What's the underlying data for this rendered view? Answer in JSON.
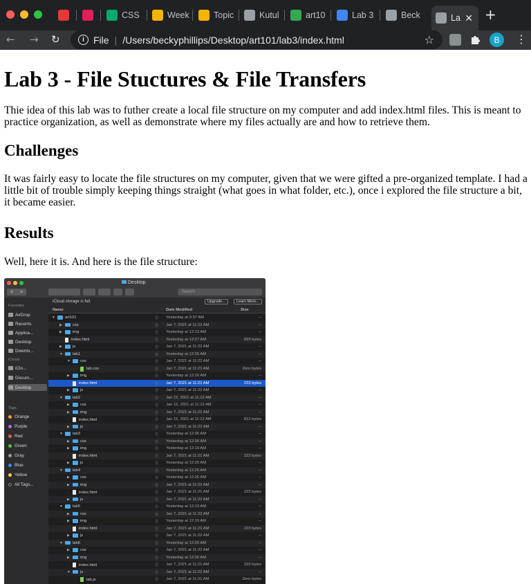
{
  "browser": {
    "tabs": [
      {
        "label": "",
        "icon": "recorder-icon",
        "color": "#e53935"
      },
      {
        "label": "",
        "icon": "slack-icon",
        "color": "#e01e5a"
      },
      {
        "label": "CSS",
        "icon": "w3schools-icon",
        "color": "#04aa6d"
      },
      {
        "label": "Week",
        "icon": "slides-icon",
        "color": "#f4b400"
      },
      {
        "label": "Topic",
        "icon": "slides-icon",
        "color": "#f4b400"
      },
      {
        "label": "Kutul",
        "icon": "globe-icon",
        "color": "#9aa0a6"
      },
      {
        "label": "art10",
        "icon": "drive-icon",
        "color": "#34a853"
      },
      {
        "label": "Lab 3",
        "icon": "docs-icon",
        "color": "#4285f4"
      },
      {
        "label": "Beck",
        "icon": "globe-icon",
        "color": "#9aa0a6"
      },
      {
        "label": "La",
        "icon": "globe-icon",
        "color": "#9aa0a6",
        "active": true
      }
    ],
    "address": {
      "scheme": "File",
      "path": "/Users/beckyphillips/Desktop/art101/lab3/index.html"
    },
    "profile_initial": "B"
  },
  "page": {
    "title": "Lab 3 - File Stuctures & File Transfers",
    "intro": "Thie idea of this lab was to futher create a local file structure on my computer and add index.html files. This is meant to practice organization, as well as demonstrate where my files actually are and how to retrieve them.",
    "challenges_heading": "Challenges",
    "challenges_text": "It was fairly easy to locate the file structures on my computer, given that we were gifted a pre-organized template. I had a little bit of trouble simply keeping things straight (what goes in what folder, etc.), once i explored the file structure a bit, it became easier.",
    "results_heading": "Results",
    "results_text": "Well, here it is. And here is the file structure:"
  },
  "finder": {
    "window_title": "Desktop",
    "search_placeholder": "Search",
    "storage_message": "iCloud storage is full.",
    "upgrade_label": "Upgrade...",
    "learn_more_label": "Learn More...",
    "columns": {
      "name": "Name",
      "date": "Date Modified",
      "size": "Size"
    },
    "sidebar": {
      "favorites_heading": "Favorites",
      "favorites": [
        "AirDrop",
        "Recents",
        "Applica...",
        "Desktop",
        "Downlo..."
      ],
      "icloud_heading": "iCloud",
      "icloud_items": [
        "iClo...",
        "Docum...",
        "Desktop"
      ],
      "tags_heading": "Tags",
      "tags": [
        {
          "label": "Orange",
          "color": "#f5a623"
        },
        {
          "label": "Purple",
          "color": "#b36ae2"
        },
        {
          "label": "Red",
          "color": "#ff5a52"
        },
        {
          "label": "Green",
          "color": "#53c63b"
        },
        {
          "label": "Gray",
          "color": "#9a9a9a"
        },
        {
          "label": "Blue",
          "color": "#3b8af0"
        },
        {
          "label": "Yellow",
          "color": "#f6d33c"
        },
        {
          "label": "All Tags...",
          "color": ""
        }
      ]
    },
    "rows": [
      {
        "name": "art101",
        "kind": "folder",
        "depth": 0,
        "open": true,
        "date": "Yesterday at 9:37 AM",
        "size": "--"
      },
      {
        "name": "css",
        "kind": "folder",
        "depth": 1,
        "open": false,
        "date": "Jan 7, 2021 at 11:22 AM",
        "size": "--"
      },
      {
        "name": "img",
        "kind": "folder",
        "depth": 1,
        "open": false,
        "date": "Yesterday at 12:13 AM",
        "size": "--"
      },
      {
        "name": "index.html",
        "kind": "file",
        "depth": 1,
        "date": "Yesterday at 12:27 AM",
        "size": "693 bytes"
      },
      {
        "name": "js",
        "kind": "folder",
        "depth": 1,
        "open": false,
        "date": "Jan 7, 2021 at 11:22 AM",
        "size": "--"
      },
      {
        "name": "lab1",
        "kind": "folder",
        "depth": 1,
        "open": true,
        "date": "Yesterday at 12:26 AM",
        "size": "--"
      },
      {
        "name": "css",
        "kind": "folder",
        "depth": 2,
        "open": true,
        "date": "Jan 7, 2021 at 11:22 AM",
        "size": "--"
      },
      {
        "name": "lab.css",
        "kind": "css",
        "depth": 3,
        "date": "Jan 7, 2021 at 11:21 AM",
        "size": "Zero bytes"
      },
      {
        "name": "img",
        "kind": "folder",
        "depth": 2,
        "open": false,
        "date": "Yesterday at 12:26 AM",
        "size": "--"
      },
      {
        "name": "index.html",
        "kind": "file",
        "depth": 2,
        "date": "Jan 7, 2021 at 11:21 AM",
        "size": "223 bytes",
        "selected": true
      },
      {
        "name": "js",
        "kind": "folder",
        "depth": 2,
        "open": false,
        "date": "Jan 7, 2021 at 11:22 AM",
        "size": "--"
      },
      {
        "name": "lab2",
        "kind": "folder",
        "depth": 1,
        "open": true,
        "date": "Jan 15, 2021 at 11:12 AM",
        "size": "--"
      },
      {
        "name": "css",
        "kind": "folder",
        "depth": 2,
        "open": false,
        "date": "Jan 15, 2021 at 11:12 AM",
        "size": "--"
      },
      {
        "name": "img",
        "kind": "folder",
        "depth": 2,
        "open": false,
        "date": "Jan 7, 2021 at 11:22 AM",
        "size": "--"
      },
      {
        "name": "index.html",
        "kind": "file",
        "depth": 2,
        "date": "Jan 15, 2021 at 11:12 AM",
        "size": "812 bytes"
      },
      {
        "name": "js",
        "kind": "folder",
        "depth": 2,
        "open": false,
        "date": "Jan 7, 2021 at 11:22 AM",
        "size": "--"
      },
      {
        "name": "lab3",
        "kind": "folder",
        "depth": 1,
        "open": true,
        "date": "Yesterday at 12:26 AM",
        "size": "--"
      },
      {
        "name": "css",
        "kind": "folder",
        "depth": 2,
        "open": false,
        "date": "Yesterday at 12:26 AM",
        "size": "--"
      },
      {
        "name": "img",
        "kind": "folder",
        "depth": 2,
        "open": false,
        "date": "Yesterday at 12:19 AM",
        "size": "--"
      },
      {
        "name": "index.html",
        "kind": "file",
        "depth": 2,
        "date": "Jan 7, 2021 at 11:21 AM",
        "size": "223 bytes"
      },
      {
        "name": "js",
        "kind": "folder",
        "depth": 2,
        "open": false,
        "date": "Yesterday at 12:26 AM",
        "size": "--"
      },
      {
        "name": "lab4",
        "kind": "folder",
        "depth": 1,
        "open": true,
        "date": "Yesterday at 12:26 AM",
        "size": "--"
      },
      {
        "name": "css",
        "kind": "folder",
        "depth": 2,
        "open": false,
        "date": "Yesterday at 12:26 AM",
        "size": "--"
      },
      {
        "name": "img",
        "kind": "folder",
        "depth": 2,
        "open": false,
        "date": "Jan 7, 2021 at 11:22 AM",
        "size": "--"
      },
      {
        "name": "index.html",
        "kind": "file",
        "depth": 2,
        "date": "Jan 7, 2021 at 11:21 AM",
        "size": "223 bytes"
      },
      {
        "name": "js",
        "kind": "folder",
        "depth": 2,
        "open": false,
        "date": "Jan 7, 2021 at 11:22 AM",
        "size": "--"
      },
      {
        "name": "lab5",
        "kind": "folder",
        "depth": 1,
        "open": true,
        "date": "Yesterday at 12:19 AM",
        "size": "--"
      },
      {
        "name": "css",
        "kind": "folder",
        "depth": 2,
        "open": false,
        "date": "Jan 7, 2021 at 11:22 AM",
        "size": "--"
      },
      {
        "name": "img",
        "kind": "folder",
        "depth": 2,
        "open": false,
        "date": "Yesterday at 12:19 AM",
        "size": "--"
      },
      {
        "name": "index.html",
        "kind": "file",
        "depth": 2,
        "date": "Jan 7, 2021 at 11:21 AM",
        "size": "223 bytes"
      },
      {
        "name": "js",
        "kind": "folder",
        "depth": 2,
        "open": false,
        "date": "Jan 7, 2021 at 11:22 AM",
        "size": "--"
      },
      {
        "name": "lab6",
        "kind": "folder",
        "depth": 1,
        "open": true,
        "date": "Yesterday at 12:26 AM",
        "size": "--"
      },
      {
        "name": "css",
        "kind": "folder",
        "depth": 2,
        "open": false,
        "date": "Jan 7, 2021 at 11:22 AM",
        "size": "--"
      },
      {
        "name": "img",
        "kind": "folder",
        "depth": 2,
        "open": false,
        "date": "Yesterday at 12:26 AM",
        "size": "--"
      },
      {
        "name": "index.html",
        "kind": "file",
        "depth": 2,
        "date": "Jan 7, 2021 at 11:21 AM",
        "size": "223 bytes"
      },
      {
        "name": "js",
        "kind": "folder",
        "depth": 2,
        "open": true,
        "date": "Jan 7, 2021 at 11:22 AM",
        "size": "--"
      },
      {
        "name": "lab.js",
        "kind": "css",
        "depth": 3,
        "date": "Jan 7, 2021 at 11:21 AM",
        "size": "Zero bytes"
      }
    ]
  }
}
